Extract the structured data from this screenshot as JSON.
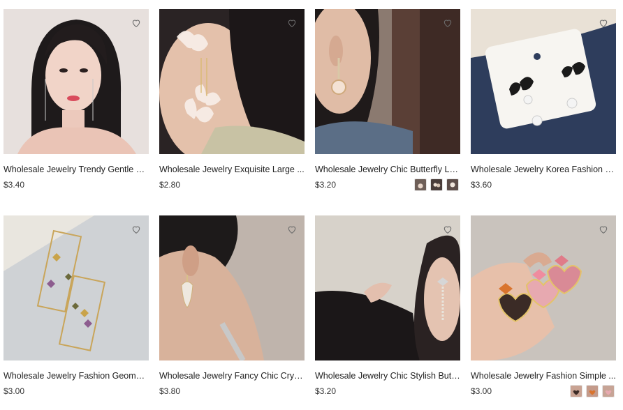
{
  "products": [
    {
      "title": "Wholesale Jewelry Trendy Gentle Cr...",
      "price": "$3.40"
    },
    {
      "title": "Wholesale Jewelry Exquisite Large ...",
      "price": "$2.80"
    },
    {
      "title": "Wholesale Jewelry Chic Butterfly La...",
      "price": "$3.20"
    },
    {
      "title": "Wholesale Jewelry Korea Fashion Bl...",
      "price": "$3.60"
    },
    {
      "title": "Wholesale Jewelry Fashion Geomet...",
      "price": "$3.00"
    },
    {
      "title": "Wholesale Jewelry Fancy Chic Cryst...",
      "price": "$3.80"
    },
    {
      "title": "Wholesale Jewelry Chic Stylish Butt...",
      "price": "$3.20"
    },
    {
      "title": "Wholesale Jewelry Fashion Simple ...",
      "price": "$3.00"
    }
  ],
  "icons": {
    "favorite": "heart-outline-icon"
  },
  "colors": {
    "text": "#1f1f1f",
    "price": "#333333",
    "heart": "#6b6b6b"
  }
}
